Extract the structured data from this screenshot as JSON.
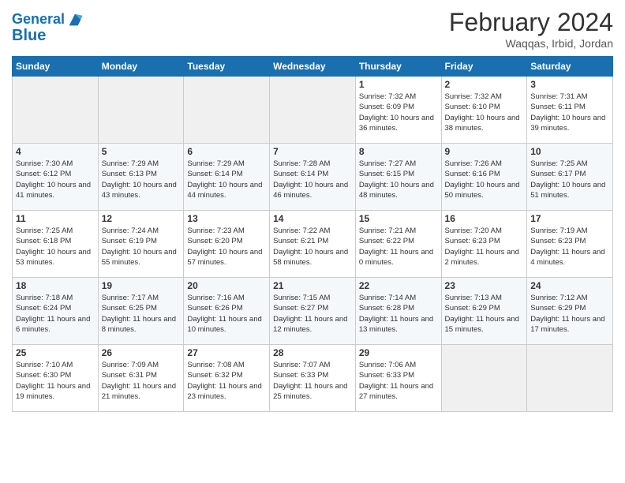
{
  "header": {
    "logo_line1": "General",
    "logo_line2": "Blue",
    "month": "February 2024",
    "location": "Waqqas, Irbid, Jordan"
  },
  "weekdays": [
    "Sunday",
    "Monday",
    "Tuesday",
    "Wednesday",
    "Thursday",
    "Friday",
    "Saturday"
  ],
  "weeks": [
    [
      {
        "day": "",
        "empty": true
      },
      {
        "day": "",
        "empty": true
      },
      {
        "day": "",
        "empty": true
      },
      {
        "day": "",
        "empty": true
      },
      {
        "day": "1",
        "sunrise": "7:32 AM",
        "sunset": "6:09 PM",
        "daylight": "10 hours and 36 minutes."
      },
      {
        "day": "2",
        "sunrise": "7:32 AM",
        "sunset": "6:10 PM",
        "daylight": "10 hours and 38 minutes."
      },
      {
        "day": "3",
        "sunrise": "7:31 AM",
        "sunset": "6:11 PM",
        "daylight": "10 hours and 39 minutes."
      }
    ],
    [
      {
        "day": "4",
        "sunrise": "7:30 AM",
        "sunset": "6:12 PM",
        "daylight": "10 hours and 41 minutes."
      },
      {
        "day": "5",
        "sunrise": "7:29 AM",
        "sunset": "6:13 PM",
        "daylight": "10 hours and 43 minutes."
      },
      {
        "day": "6",
        "sunrise": "7:29 AM",
        "sunset": "6:14 PM",
        "daylight": "10 hours and 44 minutes."
      },
      {
        "day": "7",
        "sunrise": "7:28 AM",
        "sunset": "6:14 PM",
        "daylight": "10 hours and 46 minutes."
      },
      {
        "day": "8",
        "sunrise": "7:27 AM",
        "sunset": "6:15 PM",
        "daylight": "10 hours and 48 minutes."
      },
      {
        "day": "9",
        "sunrise": "7:26 AM",
        "sunset": "6:16 PM",
        "daylight": "10 hours and 50 minutes."
      },
      {
        "day": "10",
        "sunrise": "7:25 AM",
        "sunset": "6:17 PM",
        "daylight": "10 hours and 51 minutes."
      }
    ],
    [
      {
        "day": "11",
        "sunrise": "7:25 AM",
        "sunset": "6:18 PM",
        "daylight": "10 hours and 53 minutes."
      },
      {
        "day": "12",
        "sunrise": "7:24 AM",
        "sunset": "6:19 PM",
        "daylight": "10 hours and 55 minutes."
      },
      {
        "day": "13",
        "sunrise": "7:23 AM",
        "sunset": "6:20 PM",
        "daylight": "10 hours and 57 minutes."
      },
      {
        "day": "14",
        "sunrise": "7:22 AM",
        "sunset": "6:21 PM",
        "daylight": "10 hours and 58 minutes."
      },
      {
        "day": "15",
        "sunrise": "7:21 AM",
        "sunset": "6:22 PM",
        "daylight": "11 hours and 0 minutes."
      },
      {
        "day": "16",
        "sunrise": "7:20 AM",
        "sunset": "6:23 PM",
        "daylight": "11 hours and 2 minutes."
      },
      {
        "day": "17",
        "sunrise": "7:19 AM",
        "sunset": "6:23 PM",
        "daylight": "11 hours and 4 minutes."
      }
    ],
    [
      {
        "day": "18",
        "sunrise": "7:18 AM",
        "sunset": "6:24 PM",
        "daylight": "11 hours and 6 minutes."
      },
      {
        "day": "19",
        "sunrise": "7:17 AM",
        "sunset": "6:25 PM",
        "daylight": "11 hours and 8 minutes."
      },
      {
        "day": "20",
        "sunrise": "7:16 AM",
        "sunset": "6:26 PM",
        "daylight": "11 hours and 10 minutes."
      },
      {
        "day": "21",
        "sunrise": "7:15 AM",
        "sunset": "6:27 PM",
        "daylight": "11 hours and 12 minutes."
      },
      {
        "day": "22",
        "sunrise": "7:14 AM",
        "sunset": "6:28 PM",
        "daylight": "11 hours and 13 minutes."
      },
      {
        "day": "23",
        "sunrise": "7:13 AM",
        "sunset": "6:29 PM",
        "daylight": "11 hours and 15 minutes."
      },
      {
        "day": "24",
        "sunrise": "7:12 AM",
        "sunset": "6:29 PM",
        "daylight": "11 hours and 17 minutes."
      }
    ],
    [
      {
        "day": "25",
        "sunrise": "7:10 AM",
        "sunset": "6:30 PM",
        "daylight": "11 hours and 19 minutes."
      },
      {
        "day": "26",
        "sunrise": "7:09 AM",
        "sunset": "6:31 PM",
        "daylight": "11 hours and 21 minutes."
      },
      {
        "day": "27",
        "sunrise": "7:08 AM",
        "sunset": "6:32 PM",
        "daylight": "11 hours and 23 minutes."
      },
      {
        "day": "28",
        "sunrise": "7:07 AM",
        "sunset": "6:33 PM",
        "daylight": "11 hours and 25 minutes."
      },
      {
        "day": "29",
        "sunrise": "7:06 AM",
        "sunset": "6:33 PM",
        "daylight": "11 hours and 27 minutes."
      },
      {
        "day": "",
        "empty": true
      },
      {
        "day": "",
        "empty": true
      }
    ]
  ]
}
